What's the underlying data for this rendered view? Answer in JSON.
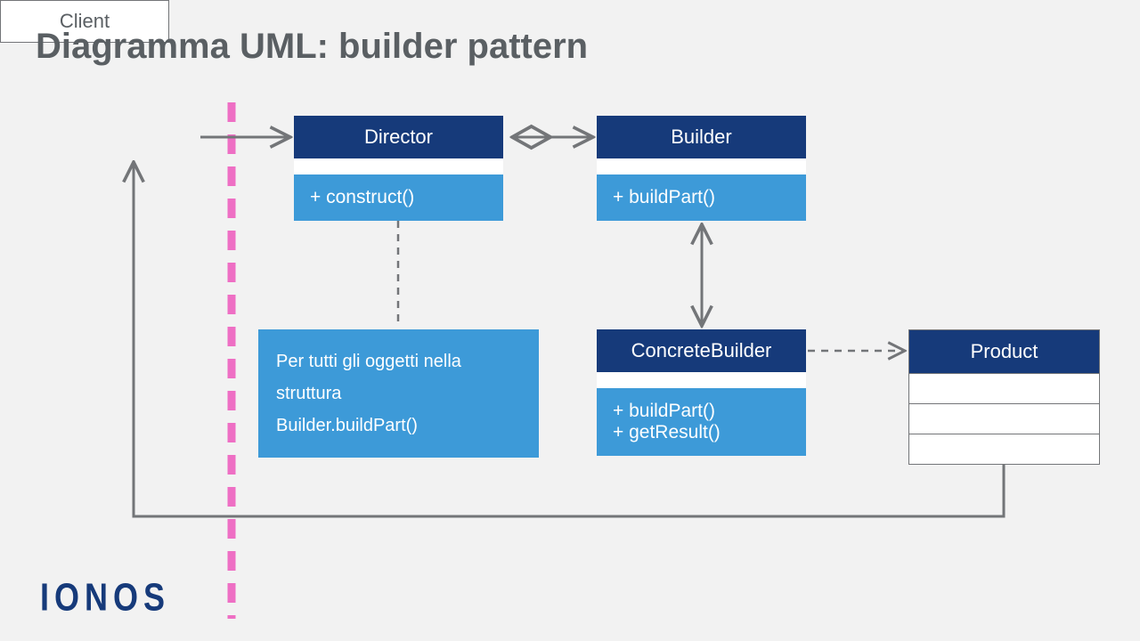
{
  "title": "Diagramma UML: builder pattern",
  "logo": "IONOS",
  "client": {
    "label": "Client"
  },
  "director": {
    "label": "Director",
    "method": "+ construct()"
  },
  "builder": {
    "label": "Builder",
    "method": "+ buildPart()"
  },
  "concrete": {
    "label": "ConcreteBuilder",
    "method1": "+ buildPart()",
    "method2": "+ getResult()"
  },
  "product": {
    "label": "Product"
  },
  "note": {
    "line1": "Per tutti gli oggetti nella",
    "line2": "struttura",
    "line3": "Builder.buildPart()"
  },
  "colors": {
    "darkblue": "#163a7a",
    "lightblue": "#3d9ad8",
    "pink": "#ee6fc4",
    "gray": "#737578"
  }
}
